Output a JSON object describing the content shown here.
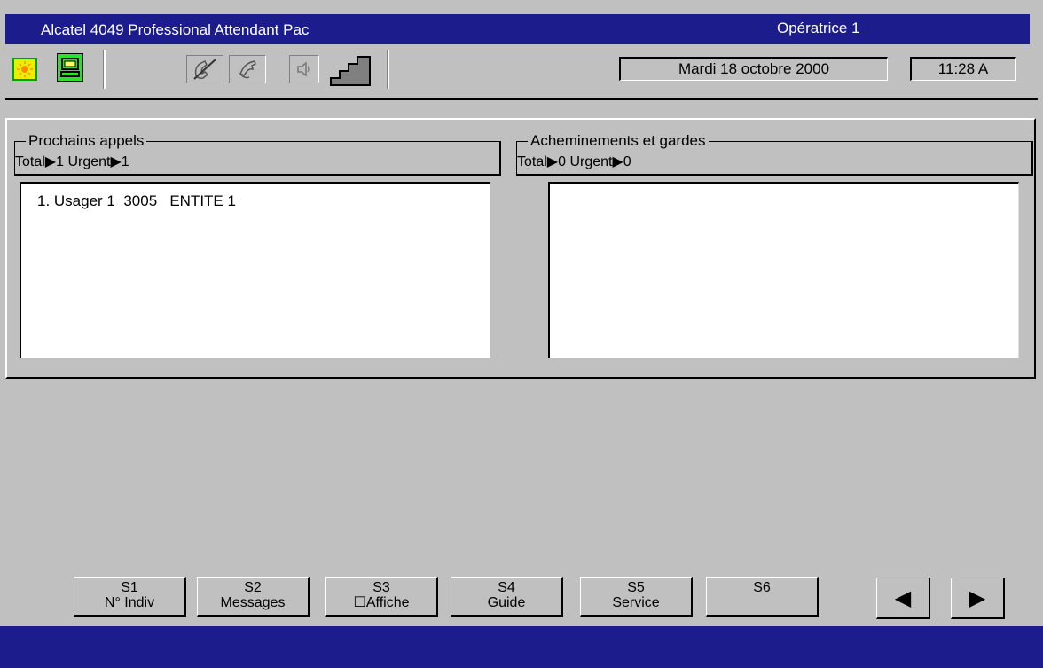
{
  "title_bar": {
    "app_title": "Alcatel 4049 Professional Attendant Pac",
    "operator": "Opératrice 1"
  },
  "toolbar": {
    "icons": [
      "sun-icon",
      "monitor-icon",
      "handset-crossed-icon",
      "handset-icon",
      "speaker-icon",
      "volume-stairs-icon"
    ],
    "date": "Mardi 18 octobre 2000",
    "time": "11:28 A"
  },
  "panels": {
    "next_calls": {
      "title": "Prochains appels",
      "counts": "Total▶1  Urgent▶1",
      "items": [
        "1. Usager 1  3005   ENTITE 1"
      ]
    },
    "routings": {
      "title": "Acheminements et gardes",
      "counts": "Total▶0  Urgent▶0",
      "items": []
    }
  },
  "function_keys": [
    {
      "key": "S1",
      "label": "N° Indiv"
    },
    {
      "key": "S2",
      "label": "Messages"
    },
    {
      "key": "S3",
      "label": "☐Affiche"
    },
    {
      "key": "S4",
      "label": "Guide"
    },
    {
      "key": "S5",
      "label": "Service"
    },
    {
      "key": "S6",
      "label": ""
    }
  ],
  "nav": {
    "prev": "◀",
    "next": "▶"
  },
  "colors": {
    "title_bar": "#1c1c8c",
    "background": "#c0c0c0",
    "status_bar": "#1c1c8c"
  }
}
